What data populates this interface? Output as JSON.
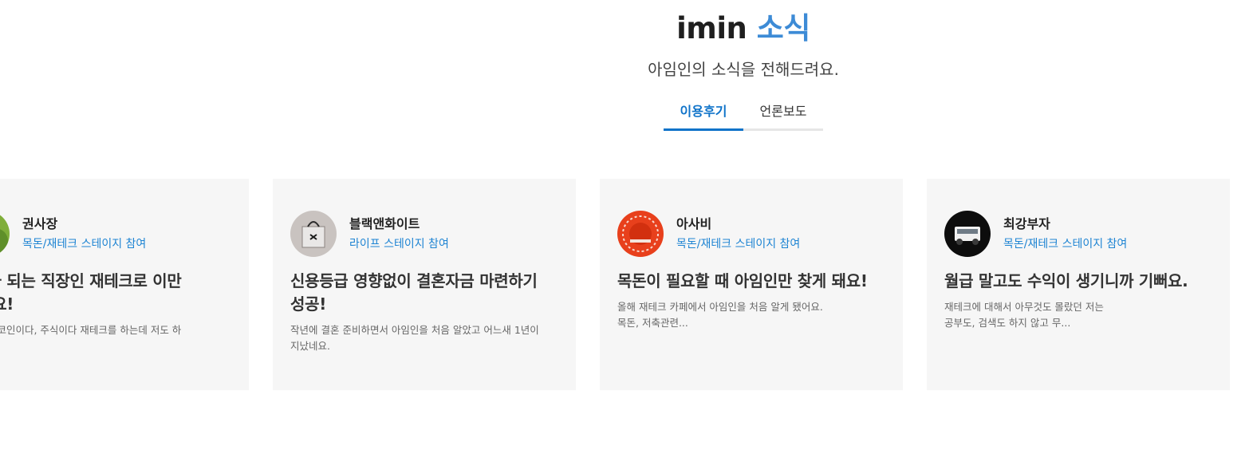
{
  "header": {
    "title_main": "imin",
    "title_accent": "소식",
    "subtitle": "아임인의 소식을 전해드려요."
  },
  "tabs": [
    {
      "label": "이용후기",
      "active": true
    },
    {
      "label": "언론보도",
      "active": false
    }
  ],
  "colors": {
    "accent": "#0f73c9",
    "stage_text": "#1e84d3",
    "title_accent": "#3d8bd6",
    "card_bg": "#f6f6f6"
  },
  "reviews": [
    {
      "name": "권사장",
      "stage": "목돈/재테크 스테이지 참여",
      "title": "+a가 되는 직장인 재테크로 이만\n없어요!",
      "body": "어 다들 코인이다, 주식이다 재테크를 하는데 저도 하\n는 해..."
    },
    {
      "name": "블랙앤화이트",
      "stage": "라이프 스테이지 참여",
      "title": "신용등급 영향없이 결혼자금 마련하기\n성공!",
      "body": "작년에 결혼 준비하면서 아임인을 처음 알았고 어느새 1년이\n지났네요."
    },
    {
      "name": "아사비",
      "stage": "목돈/재테크 스테이지 참여",
      "title": "목돈이 필요할 때 아임인만 찾게 돼요!",
      "body": "올해 재테크 카페에서 아임인을 처음 알게 됐어요.\n목돈, 저축관련..."
    },
    {
      "name": "최강부자",
      "stage": "목돈/재테크 스테이지 참여",
      "title": "월급 말고도 수익이 생기니까 기뻐요.",
      "body": "재테크에 대해서 아무것도 몰랐던 저는\n공부도, 검색도 하지 않고 무..."
    }
  ]
}
